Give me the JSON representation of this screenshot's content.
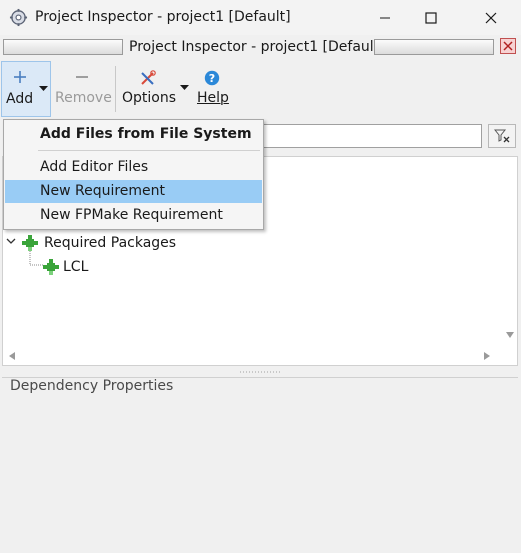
{
  "window": {
    "title": "Project Inspector - project1 [Default]",
    "caption": "Project Inspector - project1 [Default]"
  },
  "toolbar": {
    "add_label": "Add",
    "remove_label": "Remove",
    "options_label": "Options",
    "help_label": "Help"
  },
  "filter": {
    "value": ""
  },
  "tree": {
    "required_packages_label": "Required Packages",
    "lcl_label": "LCL"
  },
  "properties": {
    "title": "Dependency Properties"
  },
  "menu": {
    "items": [
      {
        "label": "Add Files from File System",
        "bold": true
      },
      {
        "label": "Add Editor Files"
      },
      {
        "label": "New Requirement",
        "highlighted": true
      },
      {
        "label": "New FPMake Requirement"
      }
    ]
  },
  "colors": {
    "menu_highlight": "#99ccf5",
    "accent_blue": "#1e88e5",
    "package_green": "#3aa43a"
  }
}
